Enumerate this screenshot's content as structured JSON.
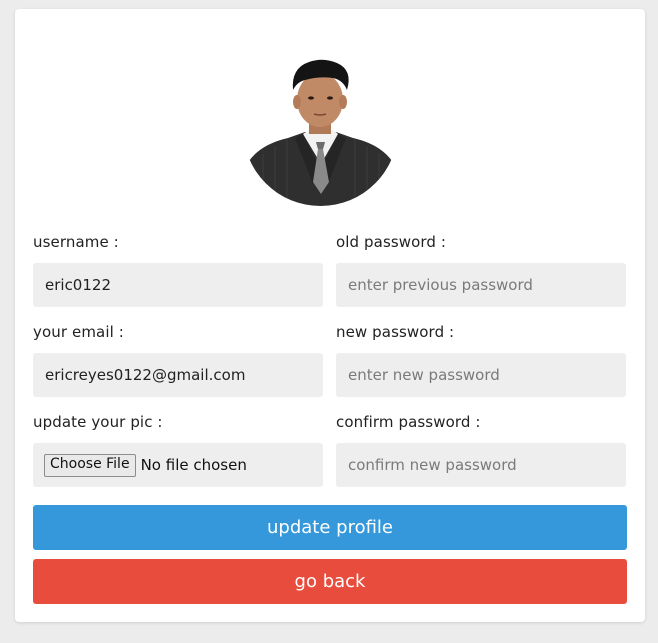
{
  "form": {
    "username_label": "username :",
    "username_value": "eric0122",
    "email_label": "your email :",
    "email_value": "ericreyes0122@gmail.com",
    "pic_label": "update your pic :",
    "file_button_label": "Choose File",
    "file_status": "No file chosen",
    "old_password_label": "old password :",
    "old_password_placeholder": "enter previous password",
    "new_password_label": "new password :",
    "new_password_placeholder": "enter new password",
    "confirm_password_label": "confirm password :",
    "confirm_password_placeholder": "confirm new password"
  },
  "actions": {
    "update_label": "update profile",
    "back_label": "go back"
  },
  "colors": {
    "update_button": "#3498db",
    "back_button": "#e74c3c",
    "input_background": "#eeeeee"
  },
  "icons": {
    "avatar": "profile-photo"
  }
}
